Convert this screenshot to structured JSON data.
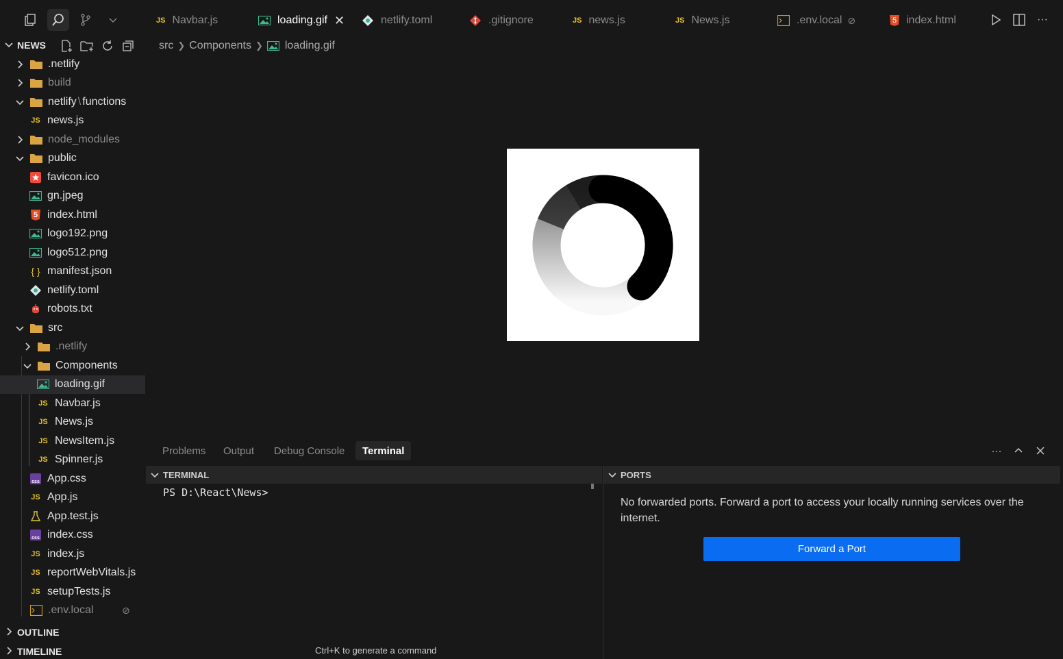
{
  "explorer": {
    "title": "NEWS",
    "tree": [
      {
        "label": ".netlify",
        "type": "folder",
        "state": "collapsed",
        "depth": 0
      },
      {
        "label": "build",
        "type": "folder",
        "state": "collapsed",
        "depth": 0
      },
      {
        "label": "netlify",
        "label2": "functions",
        "type": "folder",
        "state": "expanded",
        "depth": 0
      },
      {
        "label": "news.js",
        "type": "js",
        "depth": 1
      },
      {
        "label": "node_modules",
        "type": "folder",
        "state": "collapsed",
        "depth": 0
      },
      {
        "label": "public",
        "type": "folder",
        "state": "expanded",
        "depth": 0
      },
      {
        "label": "favicon.ico",
        "type": "favicon",
        "depth": 1
      },
      {
        "label": "gn.jpeg",
        "type": "image",
        "depth": 1
      },
      {
        "label": "index.html",
        "type": "html",
        "depth": 1
      },
      {
        "label": "logo192.png",
        "type": "image",
        "depth": 1
      },
      {
        "label": "logo512.png",
        "type": "image",
        "depth": 1
      },
      {
        "label": "manifest.json",
        "type": "json",
        "depth": 1
      },
      {
        "label": "netlify.toml",
        "type": "netlify",
        "depth": 1
      },
      {
        "label": "robots.txt",
        "type": "robot",
        "depth": 1
      },
      {
        "label": "src",
        "type": "folder",
        "state": "expanded",
        "depth": 0
      },
      {
        "label": ".netlify",
        "type": "folder",
        "state": "collapsed",
        "depth": 1
      },
      {
        "label": "Components",
        "type": "folder",
        "state": "expanded",
        "depth": 1
      },
      {
        "label": "loading.gif",
        "type": "image",
        "depth": 2,
        "selected": true
      },
      {
        "label": "Navbar.js",
        "type": "js",
        "depth": 2
      },
      {
        "label": "News.js",
        "type": "js",
        "depth": 2
      },
      {
        "label": "NewsItem.js",
        "type": "js",
        "depth": 2
      },
      {
        "label": "Spinner.js",
        "type": "js",
        "depth": 2
      },
      {
        "label": "App.css",
        "type": "css",
        "depth": 1
      },
      {
        "label": "App.js",
        "type": "js",
        "depth": 1
      },
      {
        "label": "App.test.js",
        "type": "test",
        "depth": 1
      },
      {
        "label": "index.css",
        "type": "css",
        "depth": 1
      },
      {
        "label": "index.js",
        "type": "js",
        "depth": 1
      },
      {
        "label": "reportWebVitals.js",
        "type": "js",
        "depth": 1
      },
      {
        "label": "setupTests.js",
        "type": "js",
        "depth": 1
      },
      {
        "label": ".env.local",
        "type": "env",
        "depth": 0,
        "ignored": true
      }
    ],
    "outline_label": "OUTLINE",
    "timeline_label": "TIMELINE"
  },
  "tabs": [
    {
      "label": "Navbar.js",
      "icon": "js-icon",
      "active": false
    },
    {
      "label": "loading.gif",
      "icon": "image-icon",
      "active": true
    },
    {
      "label": "netlify.toml",
      "icon": "netlify-icon",
      "active": false
    },
    {
      "label": ".gitignore",
      "icon": "git-icon",
      "active": false
    },
    {
      "label": "news.js",
      "icon": "js-icon",
      "active": false
    },
    {
      "label": "News.js",
      "icon": "js-icon",
      "active": false
    },
    {
      "label": ".env.local",
      "icon": "terminal-file-icon",
      "active": false
    },
    {
      "label": "index.html",
      "icon": "html-icon",
      "active": false
    }
  ],
  "tab_icons": {
    "js": "JS",
    "html": "5"
  },
  "breadcrumb": {
    "part1": "src",
    "part2": "Components",
    "part3": "loading.gif"
  },
  "panel": {
    "tabs": [
      "Problems",
      "Output",
      "Debug Console",
      "Terminal"
    ],
    "active_tab": "Terminal",
    "terminal_label": "TERMINAL",
    "prompt": "PS D:\\React\\News>",
    "ports_label": "PORTS",
    "ports_message": "No forwarded ports. Forward a port to access your locally running services over the internet.",
    "forward_button": "Forward a Port",
    "hint": "Ctrl+K to generate a command"
  },
  "colors": {
    "accent": "#0a6cf0",
    "js_yellow": "#e6c229",
    "image_green": "#3fb98f",
    "folder": "#d9a441"
  }
}
